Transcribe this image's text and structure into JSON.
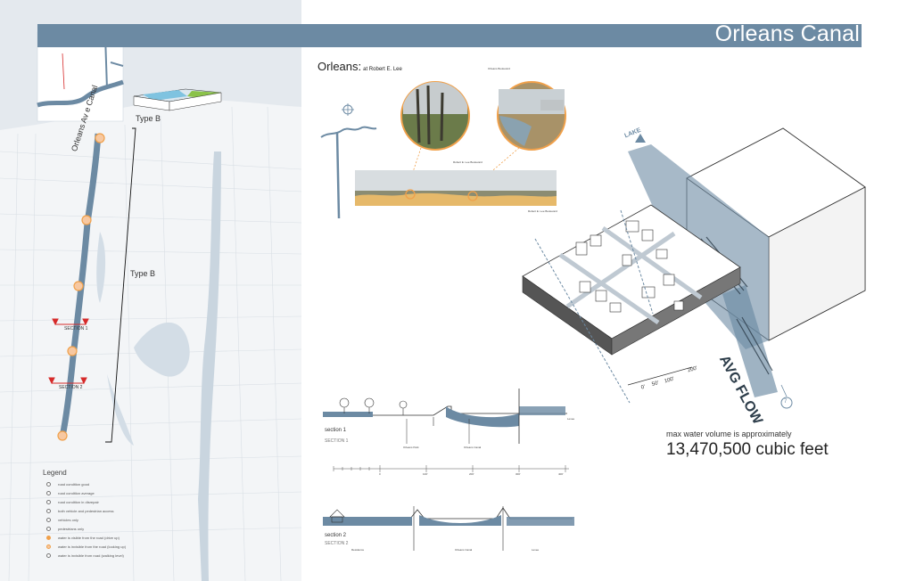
{
  "title": "Orleans Canal",
  "colors": {
    "title_bar": "#6c8aa3",
    "water": "#6f8fa8",
    "canal_blue": "#a6c3d6",
    "orange_marker": "#f0a04a",
    "red_marker": "#d62a2a",
    "map_background": "#dfe6ec",
    "roads": "#ffffff"
  },
  "map": {
    "canal_label": "Orleans Av e Canal",
    "type_b_upper": "Type B",
    "type_b_side": "Type B",
    "section_1_marker": "SECTION 1",
    "section_2_marker": "SECTION 2",
    "legend": {
      "title": "Legend",
      "items": [
        "road condition good",
        "road condition average",
        "road condition in disrepair",
        "both vehicle and pedestrian access",
        "vehicles only",
        "pedestrians only",
        "water is visible from the road (drive up)",
        "water is invisible from the road (looking up)",
        "water is invisible from road (walking level)"
      ]
    }
  },
  "location": {
    "heading": "Orleans:",
    "subheading": "at Robert E. Lee",
    "photo_caption_left": "Robert E. Lee Boulevard",
    "photo_caption_right": "Orleans Boulevard",
    "panorama_caption": "Robert E. Lee Boulevard"
  },
  "isometric": {
    "lake_label": "LAKE",
    "flow_label": "AVG FLOW",
    "scale_labels": [
      "0'",
      "50'",
      "100'",
      "200'"
    ],
    "badge": "7"
  },
  "sections": {
    "section1_title": "section 1",
    "section1_sub": "SECTION 1",
    "section1_callouts": [
      "Orleans Park",
      "Orleans Canal",
      "Levee"
    ],
    "section2_title": "section 2",
    "section2_sub": "SECTION 2",
    "section2_callouts": [
      "Residence",
      "Orleans Canal",
      "Levee"
    ],
    "scale_ticks": [
      "0",
      "100'",
      "200'",
      "300'",
      "400'"
    ]
  },
  "volume": {
    "label": "max water volume is approximately",
    "value": "13,470,500 cubic feet"
  }
}
